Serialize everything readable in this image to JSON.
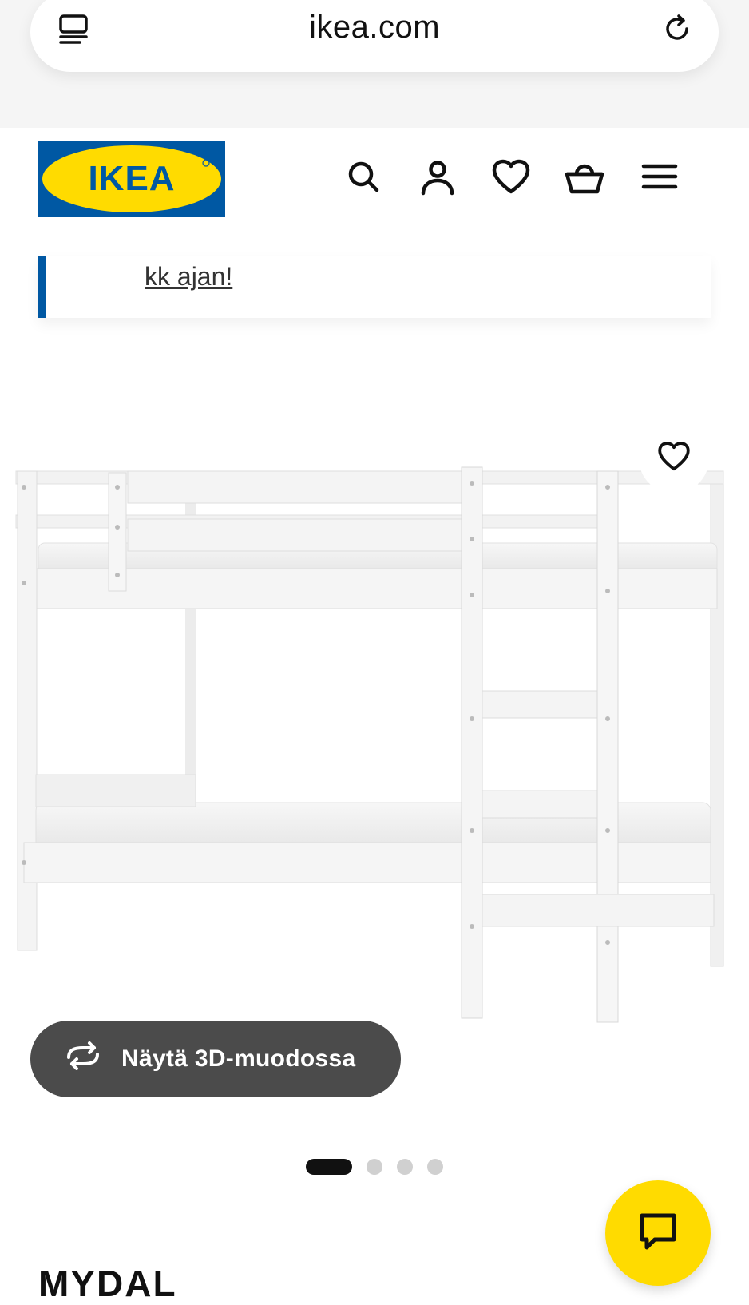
{
  "browser": {
    "url": "ikea.com"
  },
  "brand": {
    "logo_text": "IKEA",
    "blue": "#0058a3",
    "yellow": "#ffdb00"
  },
  "header": {
    "icons": [
      "search-icon",
      "account-icon",
      "wishlist-heart-icon",
      "shopping-basket-icon",
      "menu-icon"
    ]
  },
  "promo": {
    "link_text": "kk ajan!"
  },
  "gallery": {
    "view_3d_label": "Näytä 3D-muodossa",
    "total_images": 4,
    "active_index": 1
  },
  "product": {
    "name": "MYDAL"
  }
}
